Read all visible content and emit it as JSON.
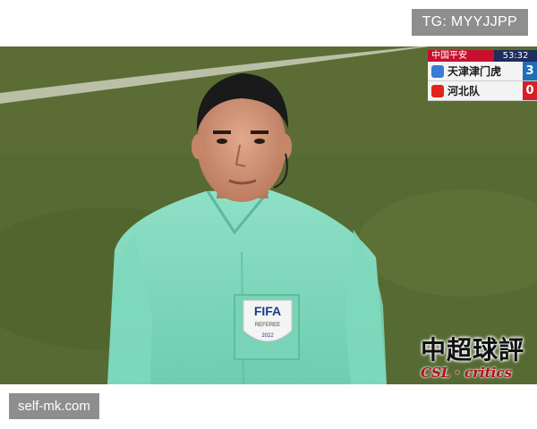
{
  "top_badge": "TG: MYYJJPP",
  "bottom_badge": "self-mk.com",
  "scorebug": {
    "league": "中国平安",
    "clock": "53:32",
    "teams": [
      {
        "name": "天津津门虎",
        "score": "3",
        "logo_color": "#3a7bd5",
        "score_bg": "#1f6fb8"
      },
      {
        "name": "河北队",
        "score": "0",
        "logo_color": "#e2231a",
        "score_bg": "#d61f26"
      }
    ]
  },
  "patch": {
    "line1": "FIFA",
    "line2": "REFEREE",
    "line3": "2022"
  },
  "watermark": {
    "chinese": "中超球評",
    "english": "CSL · critics"
  }
}
